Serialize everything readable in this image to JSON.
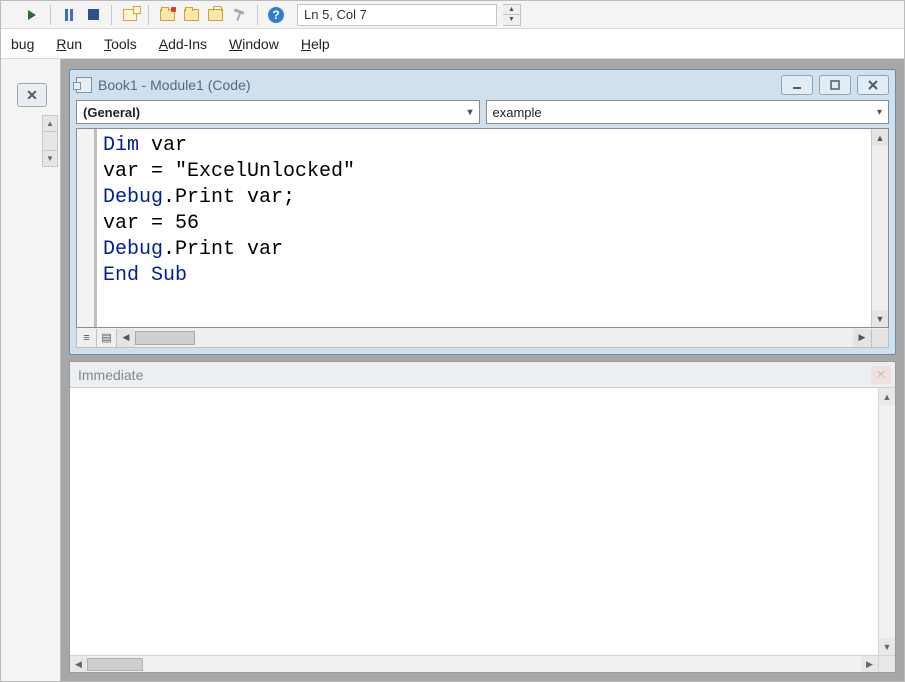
{
  "toolbar": {
    "position_readout": "Ln 5, Col 7"
  },
  "menu": {
    "items": [
      {
        "ul": "",
        "plain": "bug"
      },
      {
        "ul": "R",
        "plain": "un"
      },
      {
        "ul": "T",
        "plain": "ools"
      },
      {
        "ul": "A",
        "plain": "dd-Ins"
      },
      {
        "ul": "W",
        "plain": "indow"
      },
      {
        "ul": "H",
        "plain": "elp"
      }
    ]
  },
  "code_window": {
    "title": "Book1 - Module1 (Code)",
    "left_dropdown": "(General)",
    "right_dropdown": "example",
    "source": {
      "lines": [
        [
          {
            "t": "Dim ",
            "c": "kw"
          },
          {
            "t": "var"
          }
        ],
        [
          {
            "t": "var = \"ExcelUnlocked\""
          }
        ],
        [
          {
            "t": "Debug",
            "c": "kw"
          },
          {
            "t": ".Print var;"
          }
        ],
        [
          {
            "t": "var = 56"
          }
        ],
        [
          {
            "t": "Debug",
            "c": "kw"
          },
          {
            "t": ".Print var"
          }
        ],
        [
          {
            "t": "End Sub",
            "c": "kw"
          }
        ]
      ]
    }
  },
  "immediate": {
    "title": "Immediate"
  },
  "icons": {
    "help_glyph": "?"
  }
}
